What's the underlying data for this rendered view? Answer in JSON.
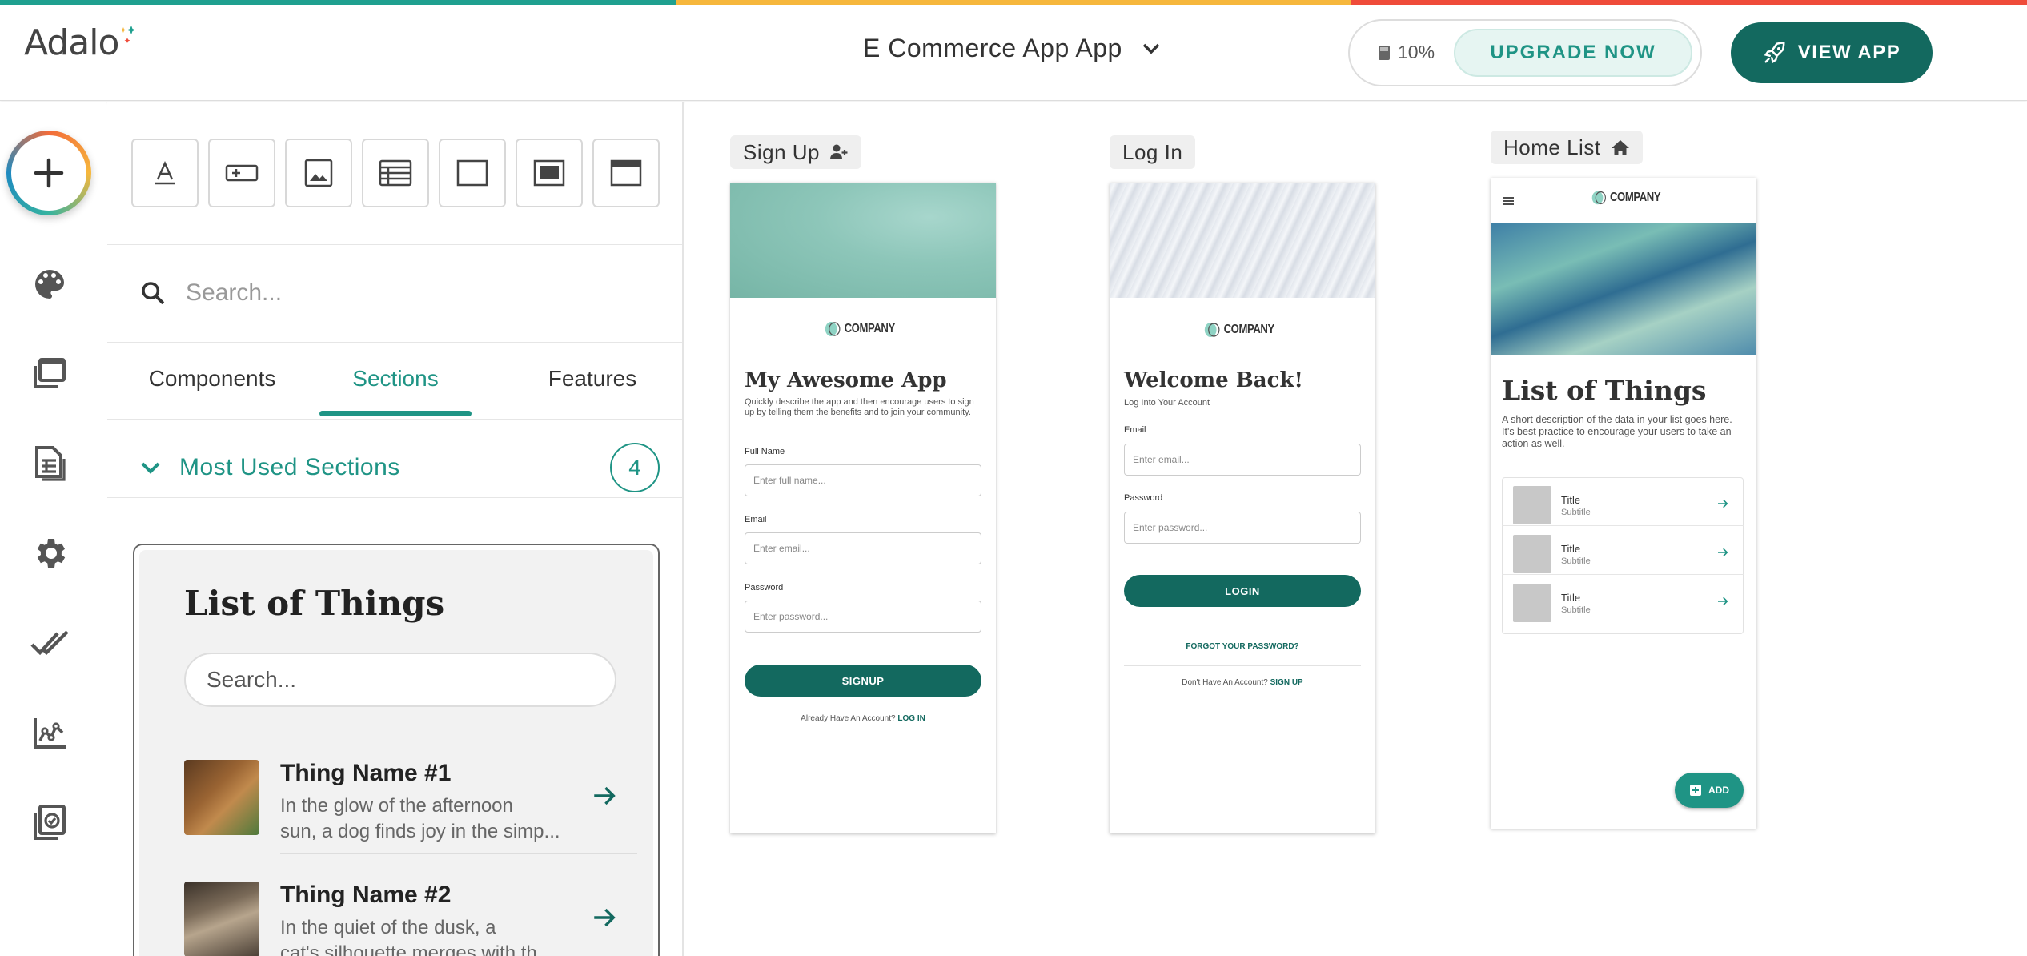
{
  "colors": {
    "brand_teal": "#1f9485",
    "dark_teal": "#13695f",
    "stripe": [
      "#1fa08f",
      "#f6b73c",
      "#ef4b3a"
    ]
  },
  "header": {
    "logo_text": "Adalo",
    "app_name": "E Commerce App App",
    "credits": "10%",
    "upgrade_label": "UPGRADE NOW",
    "view_app_label": "VIEW APP"
  },
  "rail": {
    "icons": [
      "add-icon",
      "palette-icon",
      "screens-icon",
      "database-icon",
      "settings-icon",
      "double-check-icon",
      "analytics-icon",
      "publish-icon"
    ]
  },
  "panel": {
    "tool_icons": [
      "text-icon",
      "form-field-icon",
      "image-icon",
      "list-icon",
      "rectangle-icon",
      "screen-block-icon",
      "window-icon"
    ],
    "search_placeholder": "Search...",
    "tabs": [
      {
        "label": "Components",
        "active": false
      },
      {
        "label": "Sections",
        "active": true
      },
      {
        "label": "Features",
        "active": false
      }
    ],
    "section": {
      "title": "Most Used Sections",
      "count": "4"
    },
    "preview": {
      "title": "List of Things",
      "search_placeholder": "Search...",
      "items": [
        {
          "name": "Thing Name #1",
          "desc_line1": "In the glow of the afternoon",
          "desc_line2": "sun, a dog finds joy in the simp..."
        },
        {
          "name": "Thing Name #2",
          "desc_line1": "In the quiet of the dusk, a",
          "desc_line2": "cat's silhouette merges with th..."
        }
      ]
    }
  },
  "screens": {
    "signup": {
      "label": "Sign Up",
      "company": "COMPANY",
      "heading": "My Awesome App",
      "desc": "Quickly describe the app and then encourage users to sign up by telling them the benefits and to join your community.",
      "fullname_label": "Full Name",
      "fullname_placeholder": "Enter full name...",
      "email_label": "Email",
      "email_placeholder": "Enter email...",
      "password_label": "Password",
      "password_placeholder": "Enter password...",
      "button": "SIGNUP",
      "footer_text": "Already Have An Account?",
      "footer_link": "LOG IN"
    },
    "login": {
      "label": "Log In",
      "company": "COMPANY",
      "heading": "Welcome Back!",
      "subheading": "Log Into Your Account",
      "email_label": "Email",
      "email_placeholder": "Enter email...",
      "password_label": "Password",
      "password_placeholder": "Enter password...",
      "button": "LOGIN",
      "forgot": "FORGOT YOUR PASSWORD?",
      "footer_text": "Don't Have An Account?",
      "footer_link": "SIGN UP"
    },
    "home": {
      "label": "Home List",
      "company": "COMPANY",
      "heading": "List of Things",
      "desc": "A short description of the data in your list goes here. It's best practice to encourage your users to take an action as well.",
      "items": [
        {
          "title": "Title",
          "subtitle": "Subtitle"
        },
        {
          "title": "Title",
          "subtitle": "Subtitle"
        },
        {
          "title": "Title",
          "subtitle": "Subtitle"
        }
      ],
      "fab_label": "ADD"
    }
  }
}
